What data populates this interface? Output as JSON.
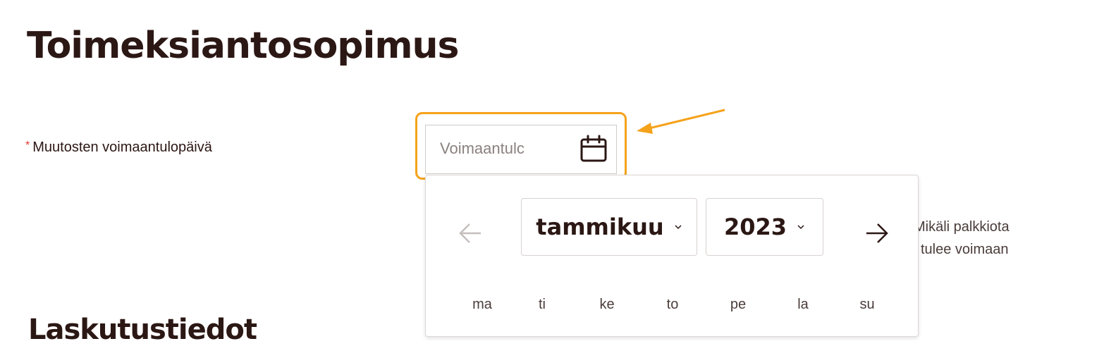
{
  "page": {
    "title": "Toimeksiantosopimus",
    "bottom_heading": "Laskutustiedot"
  },
  "form": {
    "date_field": {
      "required_marker": "*",
      "label": "Muutosten voimaantulopäivä",
      "placeholder": "Voimaantulopäivä",
      "visible_text": "Voimaantulc",
      "icon": "calendar-icon"
    },
    "helper_text_line1": "Mikäli palkkiota",
    "helper_text_line2": "tulee voimaan"
  },
  "datepicker": {
    "month": "tammikuu",
    "year": "2023",
    "prev_icon": "arrow-left-icon",
    "next_icon": "arrow-right-icon",
    "weekdays": [
      "ma",
      "ti",
      "ke",
      "to",
      "pe",
      "la",
      "su"
    ]
  },
  "colors": {
    "text": "#2b1714",
    "required": "#e03a2f",
    "highlight": "#f5a21b",
    "muted": "#8a817e",
    "disabled_arrow": "#c4bfbd"
  }
}
